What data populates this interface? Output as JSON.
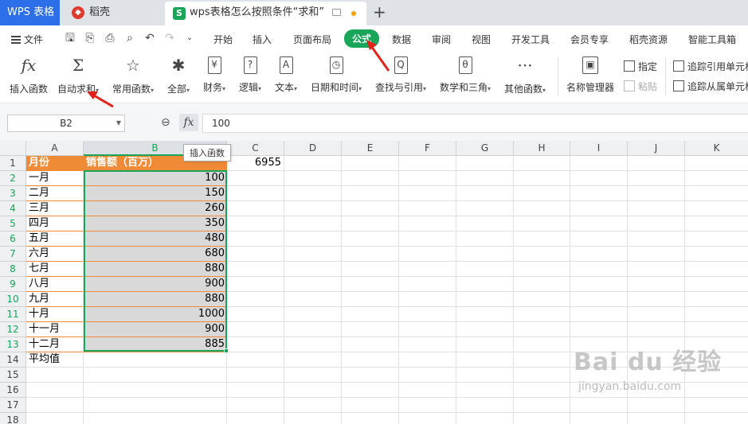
{
  "titlebar": {
    "tabs": [
      "WPS 表格",
      "稻壳",
      "wps表格怎么按照条件“求和”"
    ],
    "new_tab": "+"
  },
  "menubar": {
    "file": "文件",
    "tabs": [
      "开始",
      "插入",
      "页面布局",
      "公式",
      "数据",
      "审阅",
      "视图",
      "开发工具",
      "会员专享",
      "稻壳资源",
      "智能工具箱"
    ],
    "active": "公式"
  },
  "ribbon": {
    "buttons": [
      {
        "icon": "fx",
        "label": "插入函数"
      },
      {
        "icon": "Σ",
        "label": "自动求和"
      },
      {
        "icon": "☆",
        "label": "常用函数"
      },
      {
        "icon": "✱",
        "label": "全部"
      },
      {
        "icon": "¥",
        "label": "财务"
      },
      {
        "icon": "?",
        "label": "逻辑"
      },
      {
        "icon": "A",
        "label": "文本"
      },
      {
        "icon": "◷",
        "label": "日期和时间"
      },
      {
        "icon": "Q",
        "label": "查找与引用"
      },
      {
        "icon": "θ",
        "label": "数学和三角"
      },
      {
        "icon": "···",
        "label": "其他函数"
      },
      {
        "icon": "▣",
        "label": "名称管理器"
      }
    ],
    "name_tools": {
      "specify": "指定",
      "paste": "粘贴"
    },
    "audit": {
      "trace_precedents": "追踪引用单元格",
      "trace_dependents": "追踪从属单元格"
    }
  },
  "formula_bar": {
    "name_box": "B2",
    "fx": "fx",
    "value": "100"
  },
  "tooltip": "插入函数",
  "grid": {
    "columns": [
      "A",
      "B",
      "C",
      "D",
      "E",
      "F",
      "G",
      "H",
      "I",
      "J",
      "K"
    ],
    "rows": [
      "1",
      "2",
      "3",
      "4",
      "5",
      "6",
      "7",
      "8",
      "9",
      "10",
      "11",
      "12",
      "13",
      "14",
      "15",
      "16",
      "17",
      "18"
    ],
    "header_row": {
      "A": "月份",
      "B": "销售额（百万）",
      "C": "6955"
    },
    "data": [
      {
        "month": "一月",
        "sales": "100"
      },
      {
        "month": "二月",
        "sales": "150"
      },
      {
        "month": "三月",
        "sales": "260"
      },
      {
        "month": "四月",
        "sales": "350"
      },
      {
        "month": "五月",
        "sales": "480"
      },
      {
        "month": "六月",
        "sales": "680"
      },
      {
        "month": "七月",
        "sales": "880"
      },
      {
        "month": "八月",
        "sales": "900"
      },
      {
        "month": "九月",
        "sales": "880"
      },
      {
        "month": "十月",
        "sales": "1000"
      },
      {
        "month": "十一月",
        "sales": "900"
      },
      {
        "month": "十二月",
        "sales": "885"
      }
    ],
    "row14_label": "平均值",
    "selected_cell": "B2",
    "selected_range": "B2:B13"
  },
  "watermark": {
    "brand": "Bai du 经验",
    "url": "jingyan.baidu.com"
  },
  "colors": {
    "accent": "#19a55a",
    "header_fill": "#ef8a36",
    "wps_blue": "#2c6fe8",
    "arrow_red": "#e0241b"
  }
}
